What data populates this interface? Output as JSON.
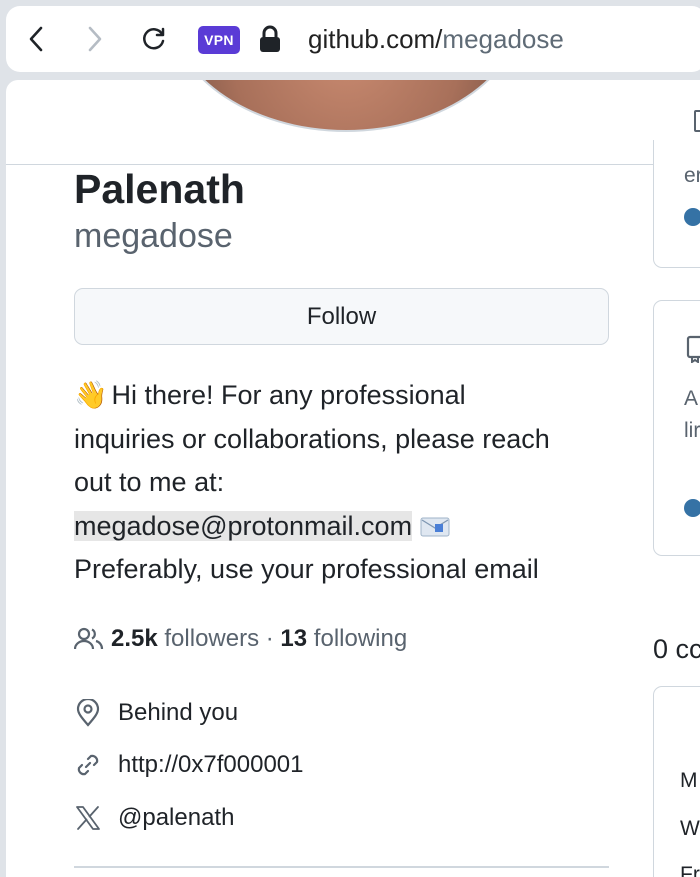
{
  "browser": {
    "vpn_label": "VPN",
    "url_domain": "github.com/",
    "url_path": "megadose"
  },
  "profile": {
    "name": "Palenath",
    "login": "megadose",
    "follow_label": "Follow",
    "bio": {
      "emoji": "👋",
      "line1": " Hi there! For any professional",
      "line2": "inquiries or collaborations, please reach",
      "line3": "out to me at:",
      "email": "megadose@protonmail.com",
      "line5": "Preferably, use your professional email"
    },
    "followers_count": "2.5k",
    "followers_label": "followers",
    "separator": " · ",
    "following_count": "13",
    "following_label": "following",
    "location": "Behind you",
    "website": "http://0x7f000001",
    "twitter": "@palenath"
  },
  "right_column": {
    "frag_en": "er",
    "frag_a": "A",
    "frag_lin": "lir",
    "frag_contrib": "0 cc",
    "frag_m": "M",
    "frag_w": "W",
    "frag_fr": "Fr"
  },
  "colors": {
    "vpn_bg": "#5a3bd6",
    "language_dot": "#3572a5",
    "tab_underline": "#fd8c73"
  }
}
